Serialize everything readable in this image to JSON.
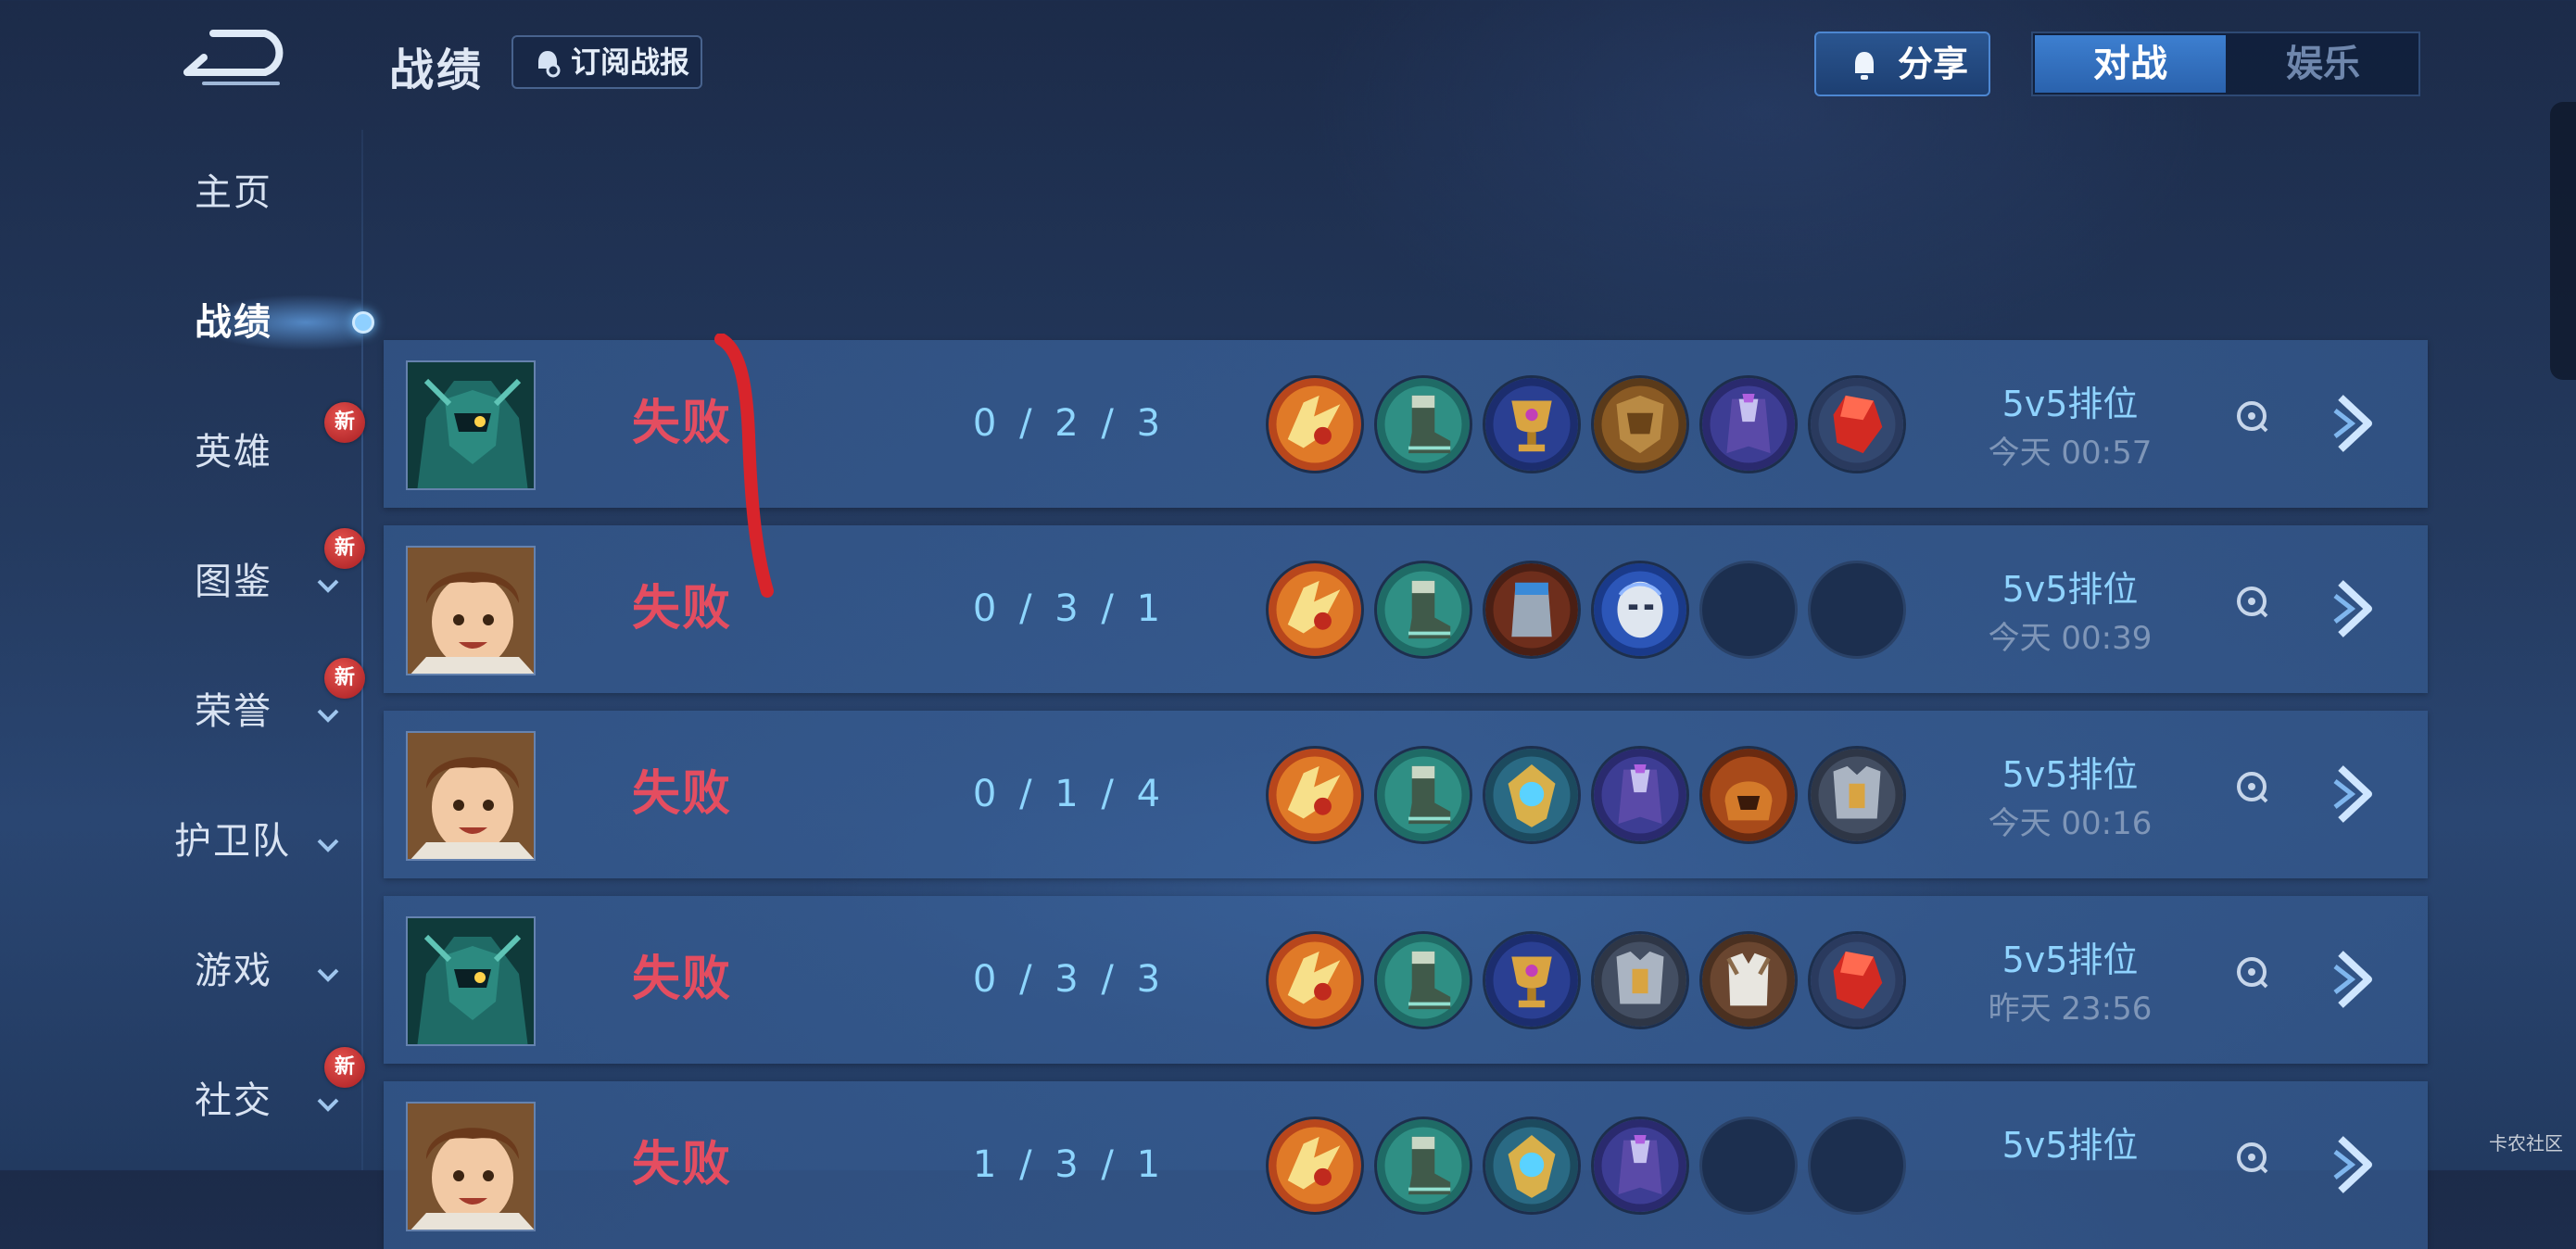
{
  "header": {
    "title": "战绩",
    "subscribe_label": "订阅战报",
    "share_label": "分享",
    "mode_tabs": [
      {
        "label": "对战",
        "active": true
      },
      {
        "label": "娱乐",
        "active": false
      }
    ]
  },
  "sidebar": {
    "items": [
      {
        "label": "主页",
        "active": false,
        "new": false,
        "expandable": false
      },
      {
        "label": "战绩",
        "active": true,
        "new": false,
        "expandable": false
      },
      {
        "label": "英雄",
        "active": false,
        "new": true,
        "expandable": false
      },
      {
        "label": "图鉴",
        "active": false,
        "new": true,
        "expandable": true
      },
      {
        "label": "荣誉",
        "active": false,
        "new": true,
        "expandable": true
      },
      {
        "label": "护卫队",
        "active": false,
        "new": false,
        "expandable": true
      },
      {
        "label": "游戏",
        "active": false,
        "new": false,
        "expandable": true
      },
      {
        "label": "社交",
        "active": false,
        "new": true,
        "expandable": true
      }
    ],
    "new_badge_text": "新"
  },
  "matches": [
    {
      "hero": "teal-armored-hero",
      "result": "失败",
      "kda": "0 / 2 / 3",
      "items": [
        "golden-wing-item",
        "green-boots-item",
        "golden-cup-item",
        "bronze-armor-item",
        "purple-cloak-item",
        "red-gem-item"
      ],
      "mode": "5v5排位",
      "time": "今天 00:57"
    },
    {
      "hero": "brown-hair-hero",
      "result": "失败",
      "kda": "0 / 3 / 1",
      "items": [
        "golden-wing-item",
        "green-boots-item",
        "blue-cloth-item",
        "silver-mask-item",
        "empty",
        "empty"
      ],
      "mode": "5v5排位",
      "time": "今天 00:39"
    },
    {
      "hero": "brown-hair-hero",
      "result": "失败",
      "kda": "0 / 1 / 4",
      "items": [
        "golden-wing-item",
        "green-boots-item",
        "blue-crest-item",
        "purple-cloak-item",
        "orange-helm-item",
        "steel-armor-item"
      ],
      "mode": "5v5排位",
      "time": "今天 00:16"
    },
    {
      "hero": "teal-armored-hero",
      "result": "失败",
      "kda": "0 / 3 / 3",
      "items": [
        "golden-wing-item",
        "green-boots-item",
        "golden-cup-item",
        "steel-armor-item",
        "white-vest-item",
        "red-gem-item"
      ],
      "mode": "5v5排位",
      "time": "昨天 23:56"
    },
    {
      "hero": "brown-hair-hero",
      "result": "失败",
      "kda": "1 / 3 / 1",
      "items": [
        "golden-wing-item",
        "green-boots-item",
        "blue-crest-item",
        "purple-cloak-item",
        "empty",
        "empty"
      ],
      "mode": "5v5排位",
      "time": ""
    }
  ],
  "watermark": "卡农社区",
  "colors": {
    "defeat": "#e44d60",
    "kda": "#8ed6ff",
    "mode": "#8fd3ff",
    "active_tab": "#3d7fd0",
    "annotation": "#d8242b"
  }
}
